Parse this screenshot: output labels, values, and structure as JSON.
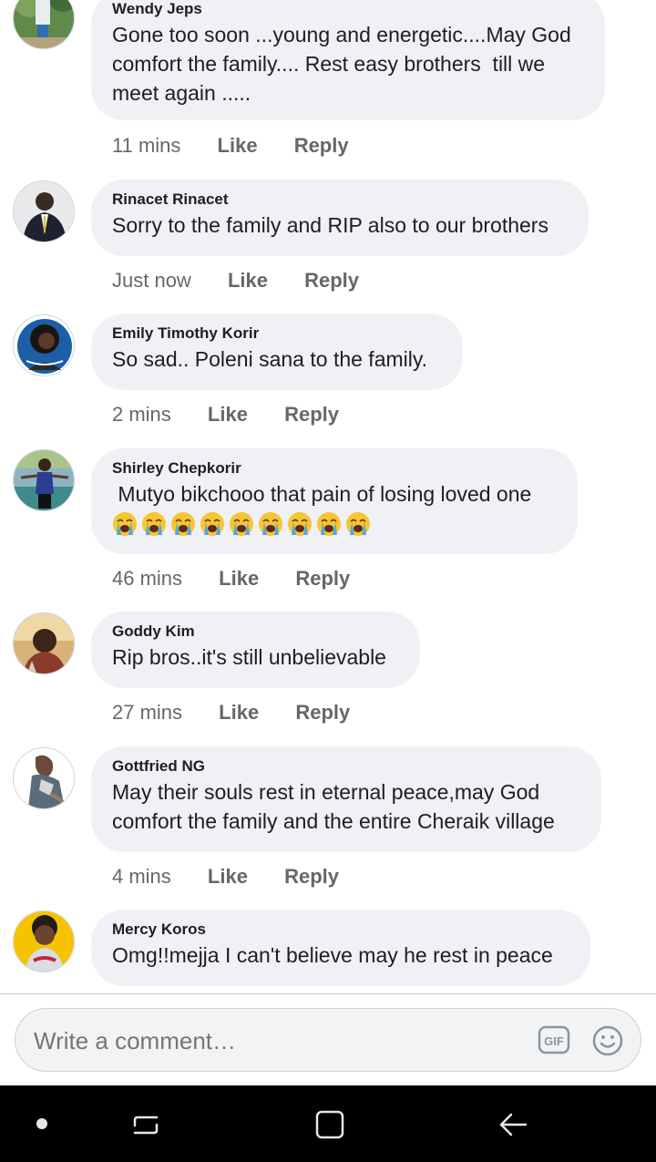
{
  "comments": [
    {
      "author": "Wendy Jeps",
      "text": "Gone too soon ...young and energetic....May God comfort the family.... Rest easy brothers  till we meet again .....",
      "time": "11 mins",
      "like": "Like",
      "reply": "Reply"
    },
    {
      "author": "Rinacet Rinacet",
      "text": "Sorry to the family and RIP also to our brothers",
      "time": "Just now",
      "like": "Like",
      "reply": "Reply"
    },
    {
      "author": "Emily Timothy Korir",
      "text": "So sad.. Poleni sana to the family.",
      "time": "2 mins",
      "like": "Like",
      "reply": "Reply"
    },
    {
      "author": "Shirley Chepkorir",
      "text": " Mutyo bikchooo that pain of losing loved one",
      "emoji": "loudly-crying-face",
      "emoji_count": 9,
      "time": "46 mins",
      "like": "Like",
      "reply": "Reply"
    },
    {
      "author": "Goddy Kim",
      "text": "Rip bros..it's still unbelievable",
      "time": "27 mins",
      "like": "Like",
      "reply": "Reply"
    },
    {
      "author": "Gottfried NG",
      "text": "May their souls rest in eternal peace,may God comfort the family and the entire Cheraik village",
      "time": "4 mins",
      "like": "Like",
      "reply": "Reply"
    },
    {
      "author": "Mercy Koros",
      "text": "Omg!!mejja I can't believe may he rest in peace"
    }
  ],
  "composer": {
    "placeholder": "Write a comment…",
    "gif_label": "GIF"
  },
  "icons": {
    "gif": "gif-icon",
    "emoji": "smiley-icon",
    "nav": [
      "nav-dot-icon",
      "recents-icon",
      "home-icon",
      "back-icon"
    ]
  },
  "colors": {
    "bubble": "#f0f1f4",
    "meta_text": "#65676b",
    "navbar": "#000000"
  }
}
